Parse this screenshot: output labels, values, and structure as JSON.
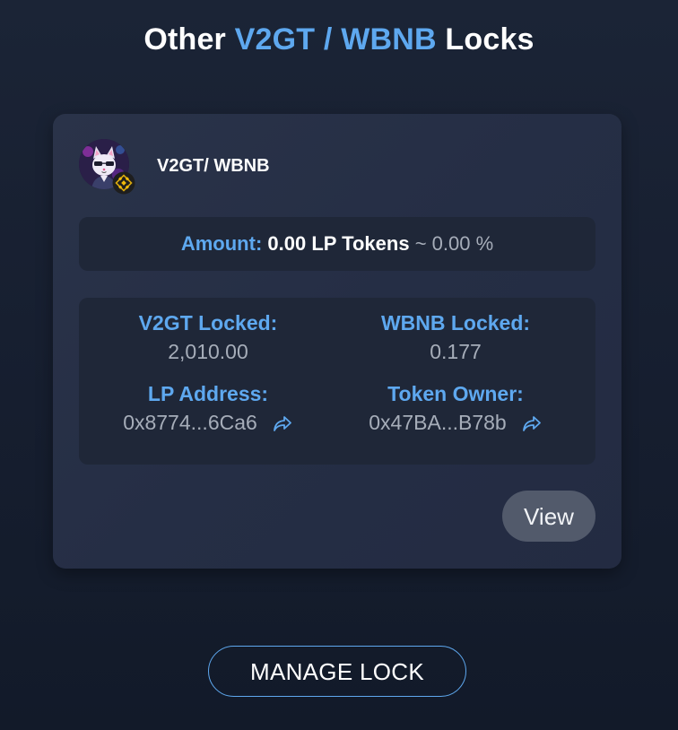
{
  "header": {
    "title_prefix": "Other",
    "title_pair": "V2GT / WBNB",
    "title_suffix": "Locks"
  },
  "lock_card": {
    "token_icon": "v2gt-token-icon",
    "chain_badge_icon": "bnb-chain-icon",
    "pair_name": "V2GT/ WBNB",
    "amount": {
      "label": "Amount:",
      "value": "0.00 LP Tokens",
      "percent": "~ 0.00 %"
    },
    "details": {
      "token0_locked_label": "V2GT Locked:",
      "token0_locked_value": "2,010.00",
      "token1_locked_label": "WBNB Locked:",
      "token1_locked_value": "0.177",
      "lp_address_label": "LP Address:",
      "lp_address_value": "0x8774...6Ca6",
      "token_owner_label": "Token Owner:",
      "token_owner_value": "0x47BA...B78b"
    },
    "view_label": "View"
  },
  "manage_lock_label": "MANAGE LOCK",
  "colors": {
    "accent": "#5ea8ef",
    "card_bg": "#283148",
    "inner_box_bg": "#1f2738",
    "muted_text": "#a6adb9",
    "view_button_bg": "#525a6b",
    "bnb_gold": "#f0b90b"
  }
}
